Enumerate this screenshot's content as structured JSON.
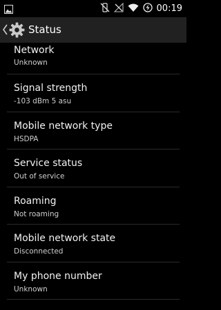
{
  "status_bar": {
    "time": "00:19",
    "icons": [
      "image-notification-icon",
      "vibrate-icon",
      "no-signal-icon",
      "wifi-icon",
      "battery-charging-icon"
    ]
  },
  "action_bar": {
    "title": "Status",
    "icon": "settings-gear-icon"
  },
  "items": [
    {
      "title": "Network",
      "summary": "Unknown"
    },
    {
      "title": "Signal strength",
      "summary": "-103 dBm   5 asu"
    },
    {
      "title": "Mobile network type",
      "summary": "HSDPA"
    },
    {
      "title": "Service status",
      "summary": "Out of service"
    },
    {
      "title": "Roaming",
      "summary": "Not roaming"
    },
    {
      "title": "Mobile network state",
      "summary": "Disconnected"
    },
    {
      "title": "My phone number",
      "summary": "Unknown"
    }
  ],
  "colors": {
    "background": "#000000",
    "action_bar": "#212121",
    "divider": "#2b2b2b"
  }
}
